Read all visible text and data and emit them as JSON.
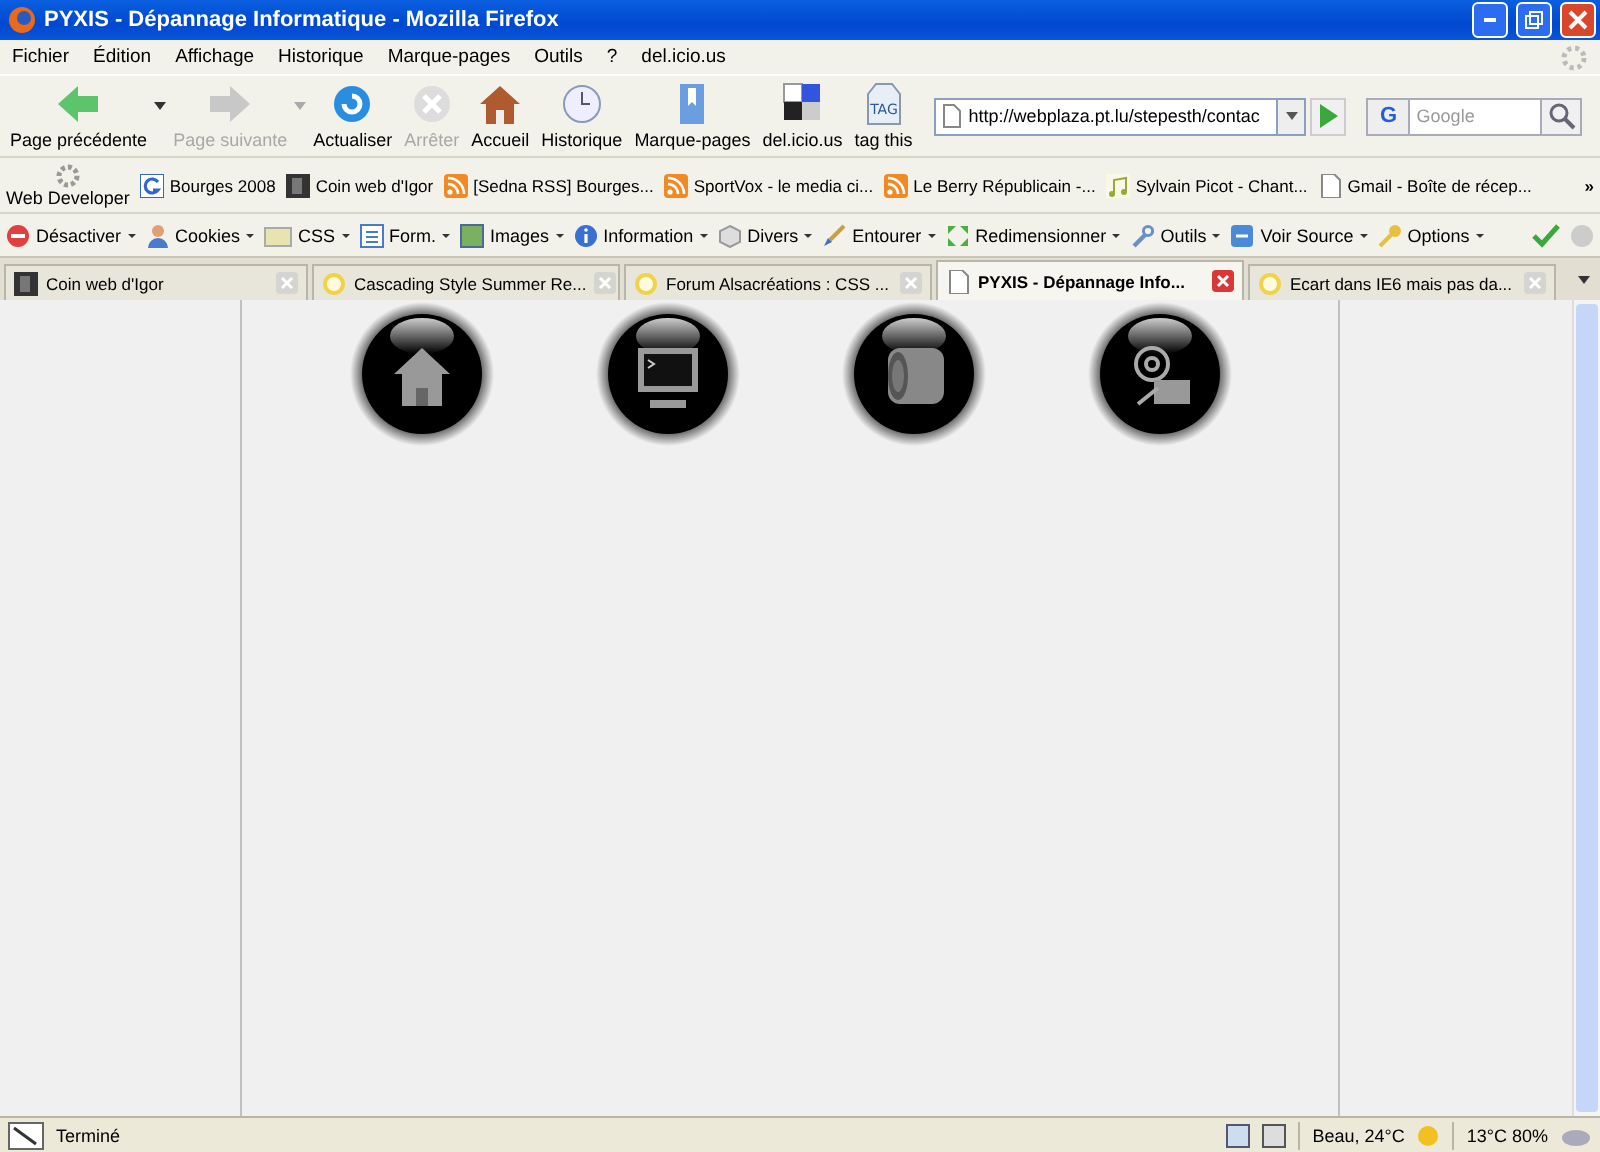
{
  "window": {
    "title": "PYXIS - Dépannage Informatique - Mozilla Firefox"
  },
  "menu": [
    "Fichier",
    "Édition",
    "Affichage",
    "Historique",
    "Marque-pages",
    "Outils",
    "?",
    "del.icio.us"
  ],
  "nav_buttons": [
    {
      "label": "Page précédente",
      "kind": "back",
      "disabled": false,
      "dropdown": true
    },
    {
      "label": "Page suivante",
      "kind": "forward",
      "disabled": true,
      "dropdown": true
    },
    {
      "label": "Actualiser",
      "kind": "reload",
      "disabled": false,
      "dropdown": false
    },
    {
      "label": "Arrêter",
      "kind": "stop",
      "disabled": true,
      "dropdown": false
    },
    {
      "label": "Accueil",
      "kind": "home",
      "disabled": false,
      "dropdown": false
    },
    {
      "label": "Historique",
      "kind": "history",
      "disabled": false,
      "dropdown": false
    },
    {
      "label": "Marque-pages",
      "kind": "bookmarks",
      "disabled": false,
      "dropdown": false
    },
    {
      "label": "del.icio.us",
      "kind": "delicious",
      "disabled": false,
      "dropdown": false
    },
    {
      "label": "tag this",
      "kind": "tag",
      "disabled": false,
      "dropdown": false
    }
  ],
  "tag_icon_text": "TAG",
  "address": {
    "value": "http://webplaza.pt.lu/stepesth/contac"
  },
  "search": {
    "placeholder": "Google",
    "engine_letter": "G"
  },
  "bookmarks_bar": {
    "developer_label": "Web Developer",
    "overflow": "»",
    "items": [
      {
        "label": "Bourges 2008",
        "kind": "google"
      },
      {
        "label": "Coin web d'Igor",
        "kind": "site"
      },
      {
        "label": "[Sedna RSS] Bourges...",
        "kind": "rss"
      },
      {
        "label": "SportVox - le media ci...",
        "kind": "rss"
      },
      {
        "label": "Le Berry Républicain -...",
        "kind": "rss"
      },
      {
        "label": "Sylvain Picot - Chant...",
        "kind": "music"
      },
      {
        "label": "Gmail - Boîte de récep...",
        "kind": "page"
      }
    ]
  },
  "developer_toolbar": [
    {
      "label": "Désactiver",
      "kind": "disable"
    },
    {
      "label": "Cookies",
      "kind": "cookies"
    },
    {
      "label": "CSS",
      "kind": "css"
    },
    {
      "label": "Form.",
      "kind": "form"
    },
    {
      "label": "Images",
      "kind": "images"
    },
    {
      "label": "Information",
      "kind": "info"
    },
    {
      "label": "Divers",
      "kind": "misc"
    },
    {
      "label": "Entourer",
      "kind": "outline"
    },
    {
      "label": "Redimensionner",
      "kind": "resize"
    },
    {
      "label": "Outils",
      "kind": "tools"
    },
    {
      "label": "Voir Source",
      "kind": "source"
    },
    {
      "label": "Options",
      "kind": "options"
    }
  ],
  "tabs": [
    {
      "label": "Coin web d'Igor",
      "kind": "site",
      "selected": false
    },
    {
      "label": "Cascading Style Summer Re...",
      "kind": "sun",
      "selected": false
    },
    {
      "label": "Forum Alsacréations : CSS ...",
      "kind": "sun",
      "selected": false
    },
    {
      "label": "PYXIS - Dépannage Info...",
      "kind": "page",
      "selected": true
    },
    {
      "label": "Ecart dans IE6 mais pas da...",
      "kind": "sun",
      "selected": false
    }
  ],
  "status_bar": {
    "text": "Terminé",
    "weather": "Beau, 24°C",
    "forecast": "13°C 80%"
  }
}
